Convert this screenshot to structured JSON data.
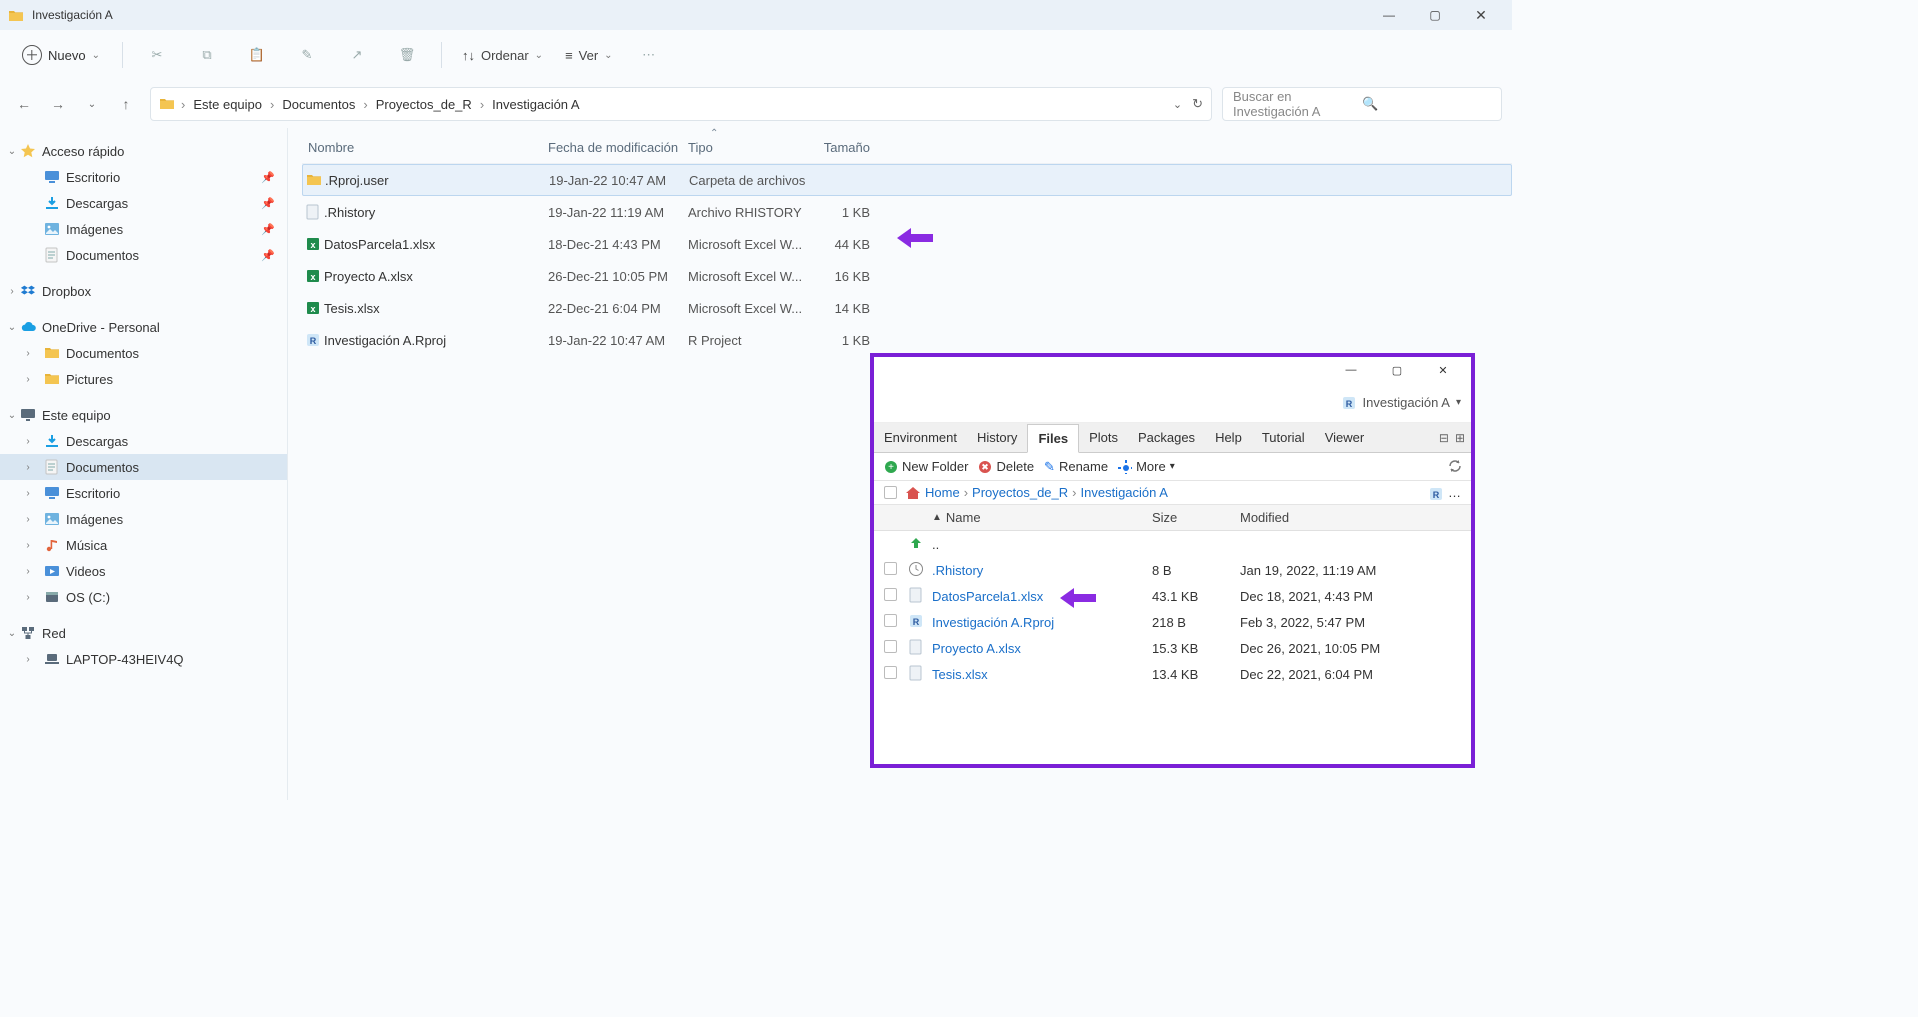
{
  "window": {
    "title": "Investigación A"
  },
  "toolbar": {
    "new_label": "Nuevo",
    "sort_label": "Ordenar",
    "view_label": "Ver"
  },
  "breadcrumb": {
    "items": [
      "Este equipo",
      "Documentos",
      "Proyectos_de_R",
      "Investigación A"
    ]
  },
  "search": {
    "placeholder": "Buscar en Investigación A"
  },
  "sidebar": {
    "quick_access": "Acceso rápido",
    "quick_items": [
      {
        "label": "Escritorio"
      },
      {
        "label": "Descargas"
      },
      {
        "label": "Imágenes"
      },
      {
        "label": "Documentos"
      }
    ],
    "dropbox": "Dropbox",
    "onedrive": "OneDrive - Personal",
    "onedrive_items": [
      {
        "label": "Documentos"
      },
      {
        "label": "Pictures"
      }
    ],
    "this_pc": "Este equipo",
    "this_pc_items": [
      {
        "label": "Descargas"
      },
      {
        "label": "Documentos"
      },
      {
        "label": "Escritorio"
      },
      {
        "label": "Imágenes"
      },
      {
        "label": "Música"
      },
      {
        "label": "Videos"
      },
      {
        "label": "OS (C:)"
      }
    ],
    "network": "Red",
    "network_items": [
      {
        "label": "LAPTOP-43HEIV4Q"
      }
    ]
  },
  "columns": {
    "name": "Nombre",
    "date": "Fecha de modificación",
    "type": "Tipo",
    "size": "Tamaño"
  },
  "files": [
    {
      "name": ".Rproj.user",
      "date": "19-Jan-22 10:47 AM",
      "type": "Carpeta de archivos",
      "size": "",
      "icon": "folder"
    },
    {
      "name": ".Rhistory",
      "date": "19-Jan-22 11:19 AM",
      "type": "Archivo RHISTORY",
      "size": "1 KB",
      "icon": "file"
    },
    {
      "name": "DatosParcela1.xlsx",
      "date": "18-Dec-21 4:43 PM",
      "type": "Microsoft Excel W...",
      "size": "44 KB",
      "icon": "excel"
    },
    {
      "name": "Proyecto A.xlsx",
      "date": "26-Dec-21 10:05 PM",
      "type": "Microsoft Excel W...",
      "size": "16 KB",
      "icon": "excel"
    },
    {
      "name": "Tesis.xlsx",
      "date": "22-Dec-21 6:04 PM",
      "type": "Microsoft Excel W...",
      "size": "14 KB",
      "icon": "excel"
    },
    {
      "name": "Investigación A.Rproj",
      "date": "19-Jan-22 10:47 AM",
      "type": "R Project",
      "size": "1 KB",
      "icon": "rproj"
    }
  ],
  "rstudio": {
    "project": "Investigación A",
    "tabs": [
      "Environment",
      "History",
      "Files",
      "Plots",
      "Packages",
      "Help",
      "Tutorial",
      "Viewer"
    ],
    "active_tab": "Files",
    "toolbar": {
      "new_folder": "New Folder",
      "delete": "Delete",
      "rename": "Rename",
      "more": "More"
    },
    "breadcrumb": [
      "Home",
      "Proyectos_de_R",
      "Investigación A"
    ],
    "columns": {
      "name": "Name",
      "size": "Size",
      "modified": "Modified"
    },
    "parent": "..",
    "files": [
      {
        "name": ".Rhistory",
        "size": "8 B",
        "modified": "Jan 19, 2022, 11:19 AM",
        "icon": "clock"
      },
      {
        "name": "DatosParcela1.xlsx",
        "size": "43.1 KB",
        "modified": "Dec 18, 2021, 4:43 PM",
        "icon": "file"
      },
      {
        "name": "Investigación A.Rproj",
        "size": "218 B",
        "modified": "Feb 3, 2022, 5:47 PM",
        "icon": "rproj"
      },
      {
        "name": "Proyecto A.xlsx",
        "size": "15.3 KB",
        "modified": "Dec 26, 2021, 10:05 PM",
        "icon": "file"
      },
      {
        "name": "Tesis.xlsx",
        "size": "13.4 KB",
        "modified": "Dec 22, 2021, 6:04 PM",
        "icon": "file"
      }
    ]
  }
}
